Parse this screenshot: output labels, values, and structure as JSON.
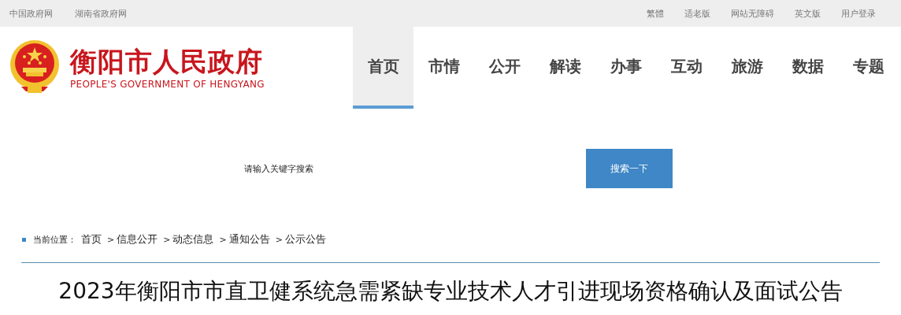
{
  "top_bar": {
    "left_links": [
      "中国政府网",
      "湖南省政府网"
    ],
    "right_links": [
      "繁體",
      "适老版",
      "网站无障碍",
      "英文版",
      "用户登录"
    ]
  },
  "header": {
    "site_title": "衡阳市人民政府",
    "site_subtitle": "PEOPLE'S GOVERNMENT OF HENGYANG"
  },
  "nav": [
    {
      "label": "首页",
      "selected": true
    },
    {
      "label": "市情",
      "selected": false
    },
    {
      "label": "公开",
      "selected": false
    },
    {
      "label": "解读",
      "selected": false
    },
    {
      "label": "办事",
      "selected": false
    },
    {
      "label": "互动",
      "selected": false
    },
    {
      "label": "旅游",
      "selected": false
    },
    {
      "label": "数据",
      "selected": false
    },
    {
      "label": "专题",
      "selected": false
    }
  ],
  "search": {
    "placeholder": "请输入关键字搜索",
    "button": "搜索一下"
  },
  "breadcrumb": {
    "label": "当前位置：",
    "items": [
      {
        "label": "首页"
      },
      {
        "separator": ">",
        "label": "信息公开"
      },
      {
        "separator": ">",
        "label": "动态信息"
      },
      {
        "separator": ">",
        "label": "通知公告"
      },
      {
        "separator": ">",
        "label": "公示公告"
      }
    ]
  },
  "article": {
    "title": "2023年衡阳市市直卫健系统急需紧缺专业技术人才引进现场资格确认及面试公告"
  }
}
